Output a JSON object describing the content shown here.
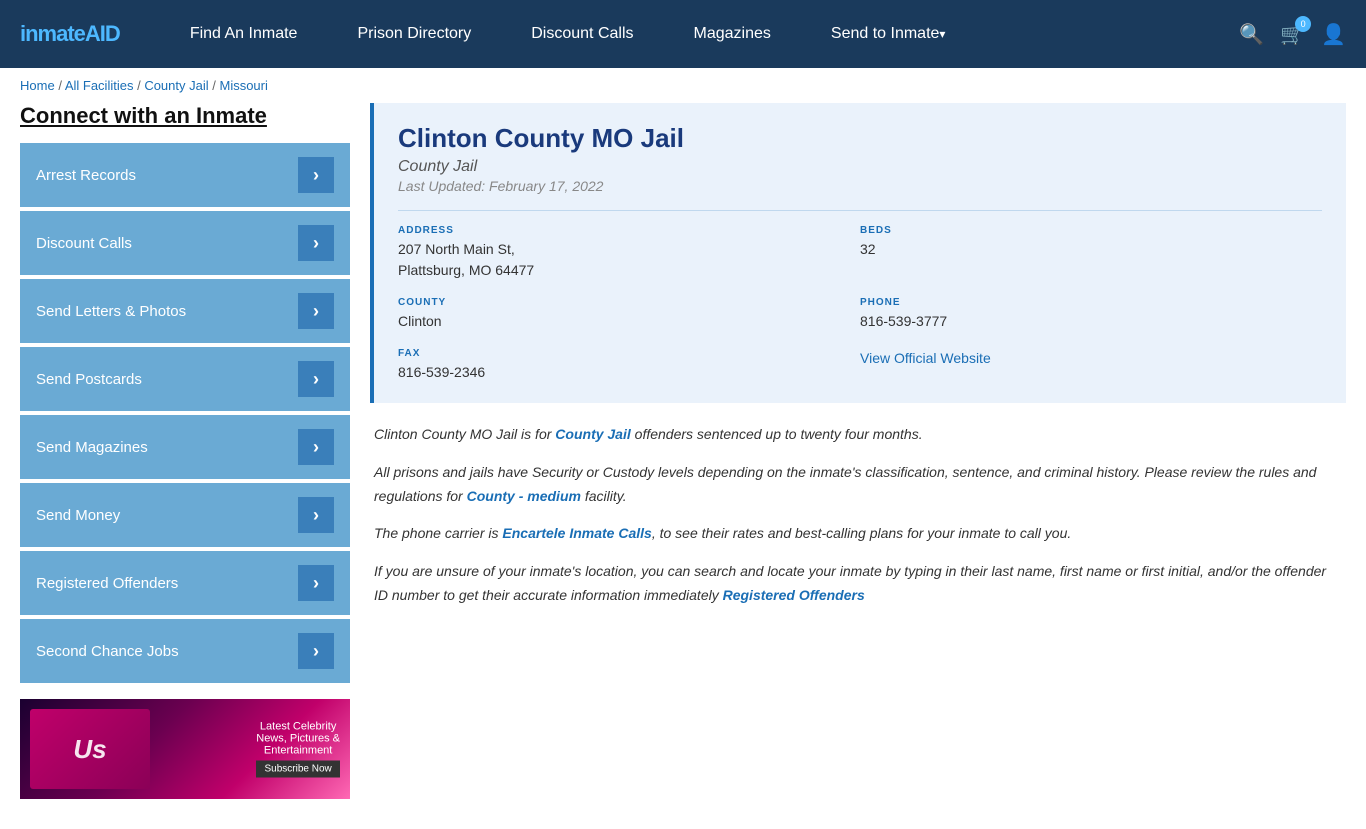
{
  "header": {
    "logo_text": "inmate",
    "logo_highlight": "AID",
    "nav": [
      {
        "label": "Find An Inmate",
        "has_arrow": false
      },
      {
        "label": "Prison Directory",
        "has_arrow": false
      },
      {
        "label": "Discount Calls",
        "has_arrow": false
      },
      {
        "label": "Magazines",
        "has_arrow": false
      },
      {
        "label": "Send to Inmate",
        "has_arrow": true
      }
    ],
    "cart_count": "0"
  },
  "breadcrumb": {
    "items": [
      {
        "label": "Home",
        "href": "#"
      },
      {
        "label": "All Facilities",
        "href": "#"
      },
      {
        "label": "County Jail",
        "href": "#"
      },
      {
        "label": "Missouri",
        "href": "#"
      }
    ]
  },
  "sidebar": {
    "title": "Connect with an Inmate",
    "menu_items": [
      "Arrest Records",
      "Discount Calls",
      "Send Letters & Photos",
      "Send Postcards",
      "Send Magazines",
      "Send Money",
      "Registered Offenders",
      "Second Chance Jobs"
    ],
    "ad": {
      "logo": "Us",
      "line1": "Latest Celebrity",
      "line2": "News, Pictures &",
      "line3": "Entertainment",
      "button": "Subscribe Now"
    }
  },
  "facility": {
    "name": "Clinton County MO Jail",
    "type": "County Jail",
    "last_updated": "Last Updated: February 17, 2022",
    "address_label": "ADDRESS",
    "address": "207 North Main St,\nPlattsburg, MO 64477",
    "beds_label": "BEDS",
    "beds": "32",
    "county_label": "COUNTY",
    "county": "Clinton",
    "phone_label": "PHONE",
    "phone": "816-539-3777",
    "fax_label": "FAX",
    "fax": "816-539-2346",
    "website_label": "View Official Website",
    "website_href": "#"
  },
  "description": {
    "para1_pre": "Clinton County MO Jail is for ",
    "para1_link": "County Jail",
    "para1_post": " offenders sentenced up to twenty four months.",
    "para2": "All prisons and jails have Security or Custody levels depending on the inmate's classification, sentence, and criminal history. Please review the rules and regulations for ",
    "para2_link": "County - medium",
    "para2_post": " facility.",
    "para3_pre": "The phone carrier is ",
    "para3_link": "Encartele Inmate Calls",
    "para3_post": ", to see their rates and best-calling plans for your inmate to call you.",
    "para4": "If you are unsure of your inmate's location, you can search and locate your inmate by typing in their last name, first name or first initial, and/or the offender ID number to get their accurate information immediately ",
    "para4_link": "Registered Offenders"
  }
}
